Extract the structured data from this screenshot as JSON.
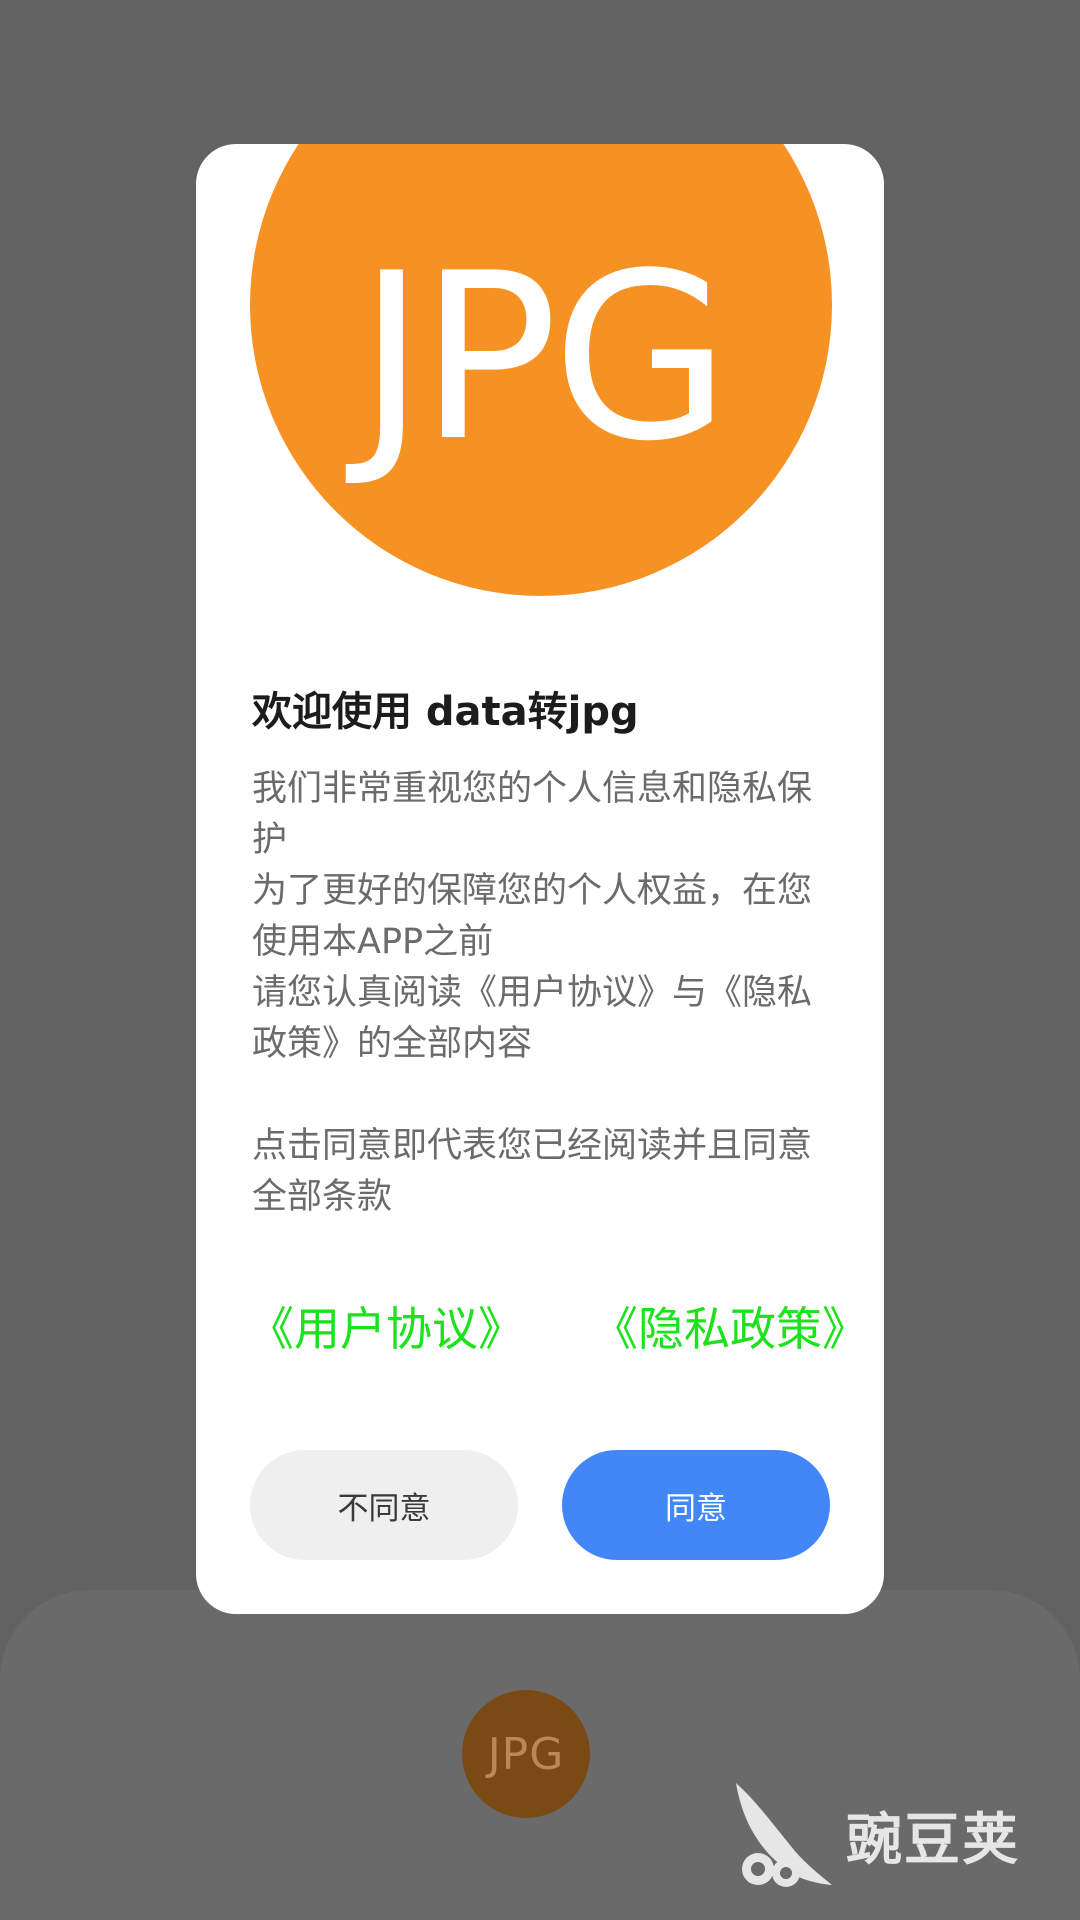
{
  "background_app": {
    "icon_text": "JPG"
  },
  "watermark": {
    "text": "豌豆荚"
  },
  "dialog": {
    "hero_text": "JPG",
    "title": "欢迎使用 data转jpg",
    "body_lines": [
      "我们非常重视您的个人信息和隐私保护",
      "为了更好的保障您的个人权益，在您使用本APP之前",
      "请您认真阅读《用户协议》与《隐私政策》的全部内容",
      "点击同意即代表您已经阅读并且同意全部条款"
    ],
    "links": {
      "user_agreement": "《用户协议》",
      "privacy_policy": "《隐私政策》"
    },
    "buttons": {
      "disagree": "不同意",
      "agree": "同意"
    }
  },
  "colors": {
    "overlay": "#626262",
    "hero_orange": "#f69223",
    "link_green": "#1ce21c",
    "agree_blue": "#4187f7",
    "disagree_gray": "#efefef"
  }
}
